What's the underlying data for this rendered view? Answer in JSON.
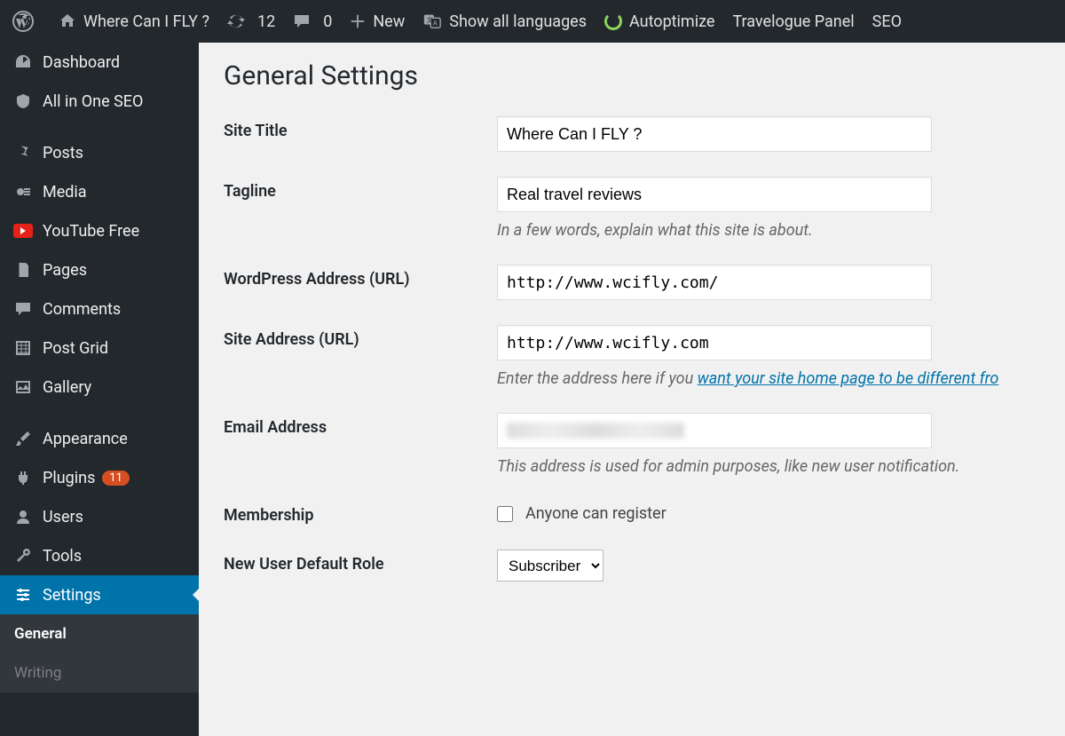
{
  "adminbar": {
    "site_name": "Where Can I FLY ?",
    "updates_count": "12",
    "comments_count": "0",
    "new_label": "New",
    "languages_label": "Show all languages",
    "autoptimize_label": "Autoptimize",
    "travelogue_label": "Travelogue Panel",
    "seo_label": "SEO"
  },
  "sidebar": {
    "dashboard": "Dashboard",
    "aioseo": "All in One SEO",
    "posts": "Posts",
    "media": "Media",
    "youtube": "YouTube Free",
    "pages": "Pages",
    "comments": "Comments",
    "postgrid": "Post Grid",
    "gallery": "Gallery",
    "appearance": "Appearance",
    "plugins": "Plugins",
    "plugins_badge": "11",
    "users": "Users",
    "tools": "Tools",
    "settings": "Settings",
    "sub_general": "General",
    "sub_writing": "Writing"
  },
  "page": {
    "title": "General Settings",
    "fields": {
      "site_title_label": "Site Title",
      "site_title_value": "Where Can I FLY ?",
      "tagline_label": "Tagline",
      "tagline_value": "Real travel reviews",
      "tagline_desc": "In a few words, explain what this site is about.",
      "wpurl_label": "WordPress Address (URL)",
      "wpurl_value": "http://www.wcifly.com/",
      "siteurl_label": "Site Address (URL)",
      "siteurl_value": "http://www.wcifly.com",
      "siteurl_desc_pre": "Enter the address here if you ",
      "siteurl_desc_link": "want your site home page to be different fro",
      "email_label": "Email Address",
      "email_desc": "This address is used for admin purposes, like new user notification.",
      "membership_label": "Membership",
      "membership_checkbox": "Anyone can register",
      "role_label": "New User Default Role",
      "role_value": "Subscriber"
    }
  }
}
